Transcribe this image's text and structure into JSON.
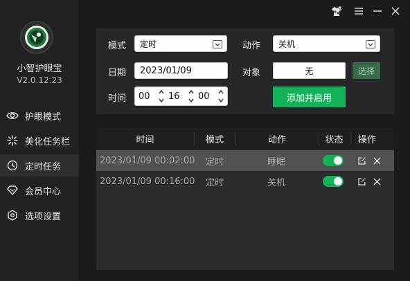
{
  "app": {
    "name": "小智护眼宝",
    "version": "V2.0.12.23"
  },
  "sidebar": {
    "items": [
      {
        "label": "护眼模式",
        "icon": "eye-icon"
      },
      {
        "label": "美化任务栏",
        "icon": "sparkle-icon"
      },
      {
        "label": "定时任务",
        "icon": "clock-icon",
        "active": true
      },
      {
        "label": "会员中心",
        "icon": "diamond-icon"
      },
      {
        "label": "选项设置",
        "icon": "gear-icon"
      }
    ]
  },
  "titlebar": {
    "icons": [
      "skin-icon",
      "menu-icon",
      "minimize-icon",
      "close-icon"
    ]
  },
  "form": {
    "mode_label": "模式",
    "mode_value": "定时",
    "action_label": "动作",
    "action_value": "关机",
    "date_label": "日期",
    "date_value": "2023/01/09",
    "target_label": "对象",
    "target_value": "无",
    "choose_label": "选择",
    "time_label": "时间",
    "time_h": "00",
    "time_m": "16",
    "time_s": "00",
    "add_button": "添加并启用"
  },
  "table": {
    "headers": [
      "时间",
      "模式",
      "动作",
      "状态",
      "操作"
    ],
    "rows": [
      {
        "time": "2023/01/09 00:02:00",
        "mode": "定时",
        "action": "睡眠",
        "enabled": true,
        "selected": true
      },
      {
        "time": "2023/01/09 00:16:00",
        "mode": "定时",
        "action": "关机",
        "enabled": true,
        "selected": false
      }
    ]
  },
  "colors": {
    "accent_green": "#12b259",
    "sidebar_bg": "#212124",
    "main_bg": "#1b1b1d"
  }
}
